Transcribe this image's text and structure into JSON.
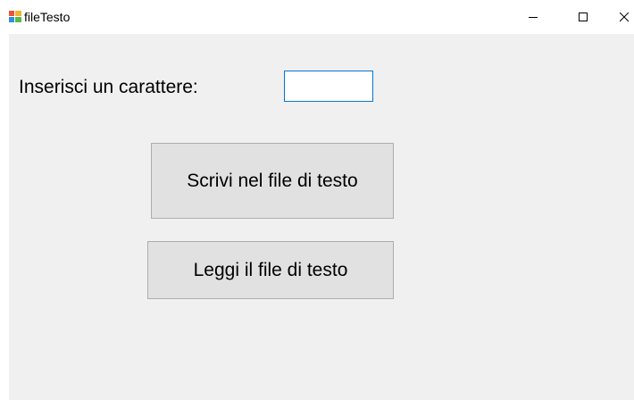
{
  "window": {
    "title": "fileTesto",
    "icon": "winforms-app-icon",
    "controls": {
      "minimize_icon": "minimize-icon",
      "maximize_icon": "maximize-icon",
      "close_icon": "close-icon"
    }
  },
  "form": {
    "input_label": "Inserisci un carattere:",
    "input_value": "",
    "write_button_label": "Scrivi nel file di testo",
    "read_button_label": "Leggi il file di testo"
  },
  "colors": {
    "client_background": "#f0f0f0",
    "button_background": "#e1e1e1",
    "button_border": "#adadad",
    "textbox_focus_border": "#0078d7"
  }
}
